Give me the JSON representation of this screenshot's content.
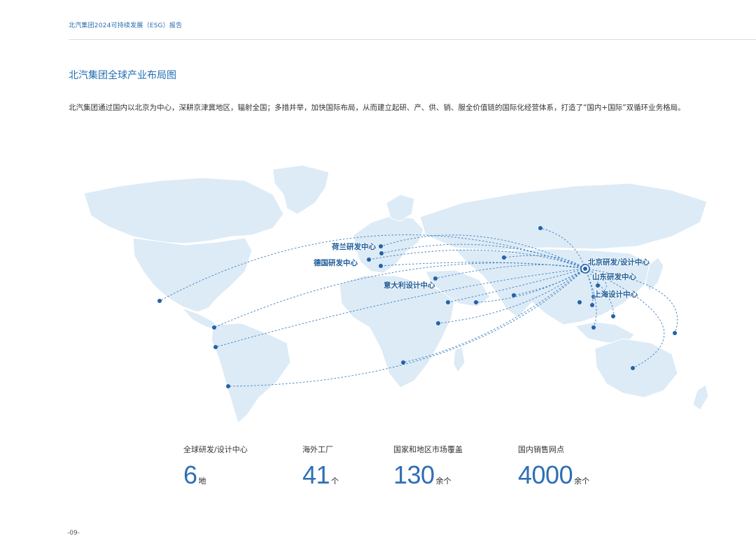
{
  "header": {
    "report_title": "北汽集团2024可持续发展（ESG）报告"
  },
  "section": {
    "title": "北汽集团全球产业布局图",
    "intro": "北汽集团通过国内以北京为中心，深耕京津冀地区，辐射全国；多措并举，加快国际布局，从而建立起研、产、供、销、服全价值链的国际化经营体系，打造了“国内+国际”双循环业务格局。"
  },
  "map": {
    "hub": "北京研发/设计中心",
    "labels": {
      "netherlands": "荷兰研发中心",
      "germany": "德国研发中心",
      "italy": "意大利设计中心",
      "beijing": "北京研发/设计中心",
      "shandong": "山东研发中心",
      "shanghai": "上海设计中心"
    },
    "colors": {
      "land": "#dcebf6",
      "land_edge": "#ffffff",
      "route": "#3a7cc0",
      "dot": "#2461a8"
    }
  },
  "stats": [
    {
      "label": "全球研发/设计中心",
      "value": "6",
      "unit": "地"
    },
    {
      "label": "海外工厂",
      "value": "41",
      "unit": "个"
    },
    {
      "label": "国家和地区市场覆盖",
      "value": "130",
      "unit": "余个"
    },
    {
      "label": "国内销售网点",
      "value": "4000",
      "unit": "余个"
    }
  ],
  "footer": {
    "page": "-09-"
  }
}
